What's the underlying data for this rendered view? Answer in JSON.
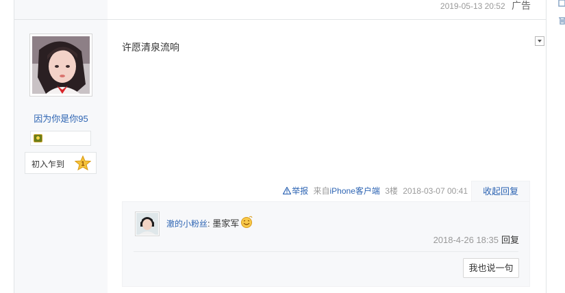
{
  "prev_post": {
    "timestamp": "2019-05-13 20:52",
    "ad_label": "广告"
  },
  "user": {
    "name": "因为你是你95",
    "level_title": "初入乍到",
    "level_number": "1"
  },
  "post": {
    "body": "许愿清泉流响",
    "report_label": "举报",
    "source": "来自",
    "client": "iPhone客户端",
    "floor": "3楼",
    "timestamp": "2018-03-07 00:41",
    "collapse_label": "收起回复"
  },
  "reply": {
    "user": "澈的小粉丝",
    "colon": ":",
    "text": "墨家军",
    "timestamp": "2018-4-26 18:35",
    "reply_label": "回复",
    "say_button": "我也说一句"
  },
  "icons": [
    "edit-icon",
    "trash-icon",
    "dropdown-arrow-icon",
    "warning-icon",
    "smiley-icon",
    "star-icon",
    "badge-icon"
  ],
  "colors": {
    "link": "#2d64b3",
    "muted": "#999999",
    "panel": "#f7f8fa"
  }
}
